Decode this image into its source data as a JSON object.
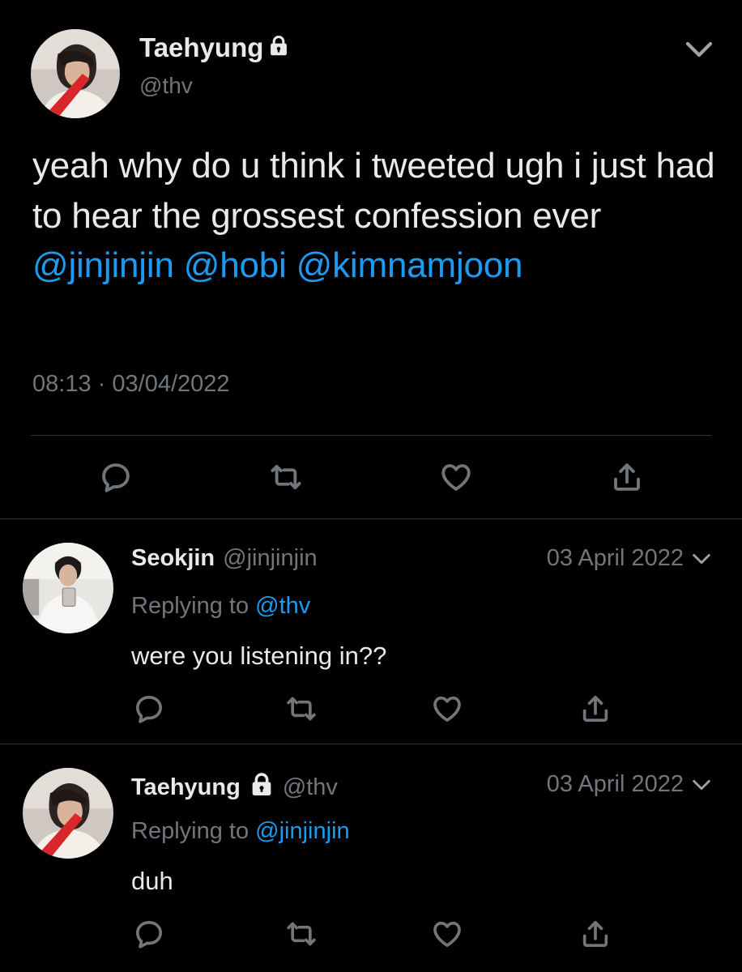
{
  "main_tweet": {
    "display_name": "Taehyung",
    "handle": "@thv",
    "text_plain": "yeah why do u think i tweeted ugh i just had to hear the grossest confession ever ",
    "mentions": [
      "@jinjinjin",
      "@hobi",
      "@kimnamjoon"
    ],
    "time": "08:13",
    "separator": "·",
    "date": "03/04/2022",
    "icons": {
      "protected": "lock-icon",
      "menu": "chevron-down-icon",
      "reply": "reply-icon",
      "retweet": "retweet-icon",
      "like": "heart-icon",
      "share": "share-icon"
    }
  },
  "replies": [
    {
      "display_name": "Seokjin",
      "handle": "@jinjinjin",
      "date": "03 April 2022",
      "replying_label": "Replying to",
      "replying_to": "@thv",
      "text": "were you listening in??"
    },
    {
      "display_name": "Taehyung",
      "handle": "@thv",
      "date": "03 April 2022",
      "replying_label": "Replying to",
      "replying_to": "@jinjinjin",
      "text": "duh"
    }
  ],
  "colors": {
    "background": "#000000",
    "text": "#e7e9ea",
    "secondary": "#71767b",
    "accent": "#1d9bf0",
    "divider": "#2f3336"
  }
}
